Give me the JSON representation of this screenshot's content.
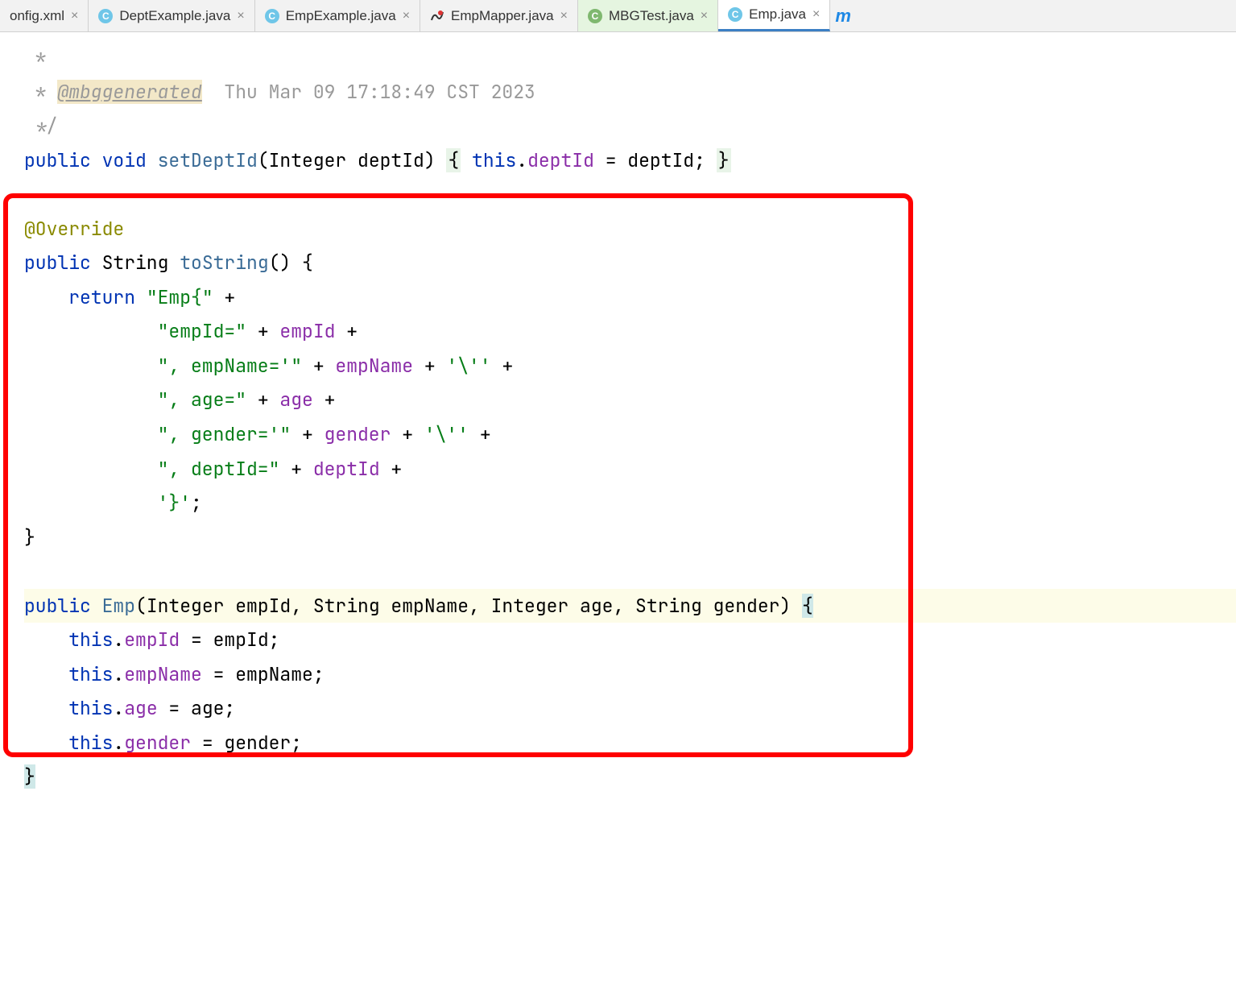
{
  "tabs": [
    {
      "label": "onfig.xml",
      "icon": null
    },
    {
      "label": "DeptExample.java",
      "icon": "c"
    },
    {
      "label": "EmpExample.java",
      "icon": "c"
    },
    {
      "label": "EmpMapper.java",
      "icon": "mapper"
    },
    {
      "label": "MBGTest.java",
      "icon": "c-green"
    },
    {
      "label": "Emp.java",
      "icon": "c"
    }
  ],
  "close_x": "×",
  "m_icon": "m",
  "code": {
    "c0": " *",
    "c1_pre": " * ",
    "c1_anno": "@mbggenerated",
    "c1_post": "  Thu Mar 09 17:18:49 CST 2023",
    "c2": " */",
    "l3_pub": "public ",
    "l3_void": "void ",
    "l3_method": "setDeptId",
    "l3_lparen": "(Integer deptId) ",
    "l3_lbrace": "{",
    "l3_this": " this",
    "l3_dot": ".",
    "l3_field": "deptId",
    "l3_assign": " = deptId; ",
    "l3_rbrace": "}",
    "l5_override": "@Override",
    "l6_pub": "public ",
    "l6_str": "String ",
    "l6_method": "toString",
    "l6_rest": "() {",
    "l7_return": "    return ",
    "l7_str": "\"Emp{\"",
    "l7_plus": " +",
    "l8_str": "            \"empId=\"",
    "l8_plus": " + ",
    "l8_field": "empId",
    "l8_plus2": " +",
    "l9_str": "            \", empName='\"",
    "l9_plus": " + ",
    "l9_field": "empName",
    "l9_plus2": " + ",
    "l9_str2": "'\\''",
    "l9_plus3": " +",
    "l10_str": "            \", age=\"",
    "l10_plus": " + ",
    "l10_field": "age",
    "l10_plus2": " +",
    "l11_str": "            \", gender='\"",
    "l11_plus": " + ",
    "l11_field": "gender",
    "l11_plus2": " + ",
    "l11_str2": "'\\''",
    "l11_plus3": " +",
    "l12_str": "            \", deptId=\"",
    "l12_plus": " + ",
    "l12_field": "deptId",
    "l12_plus2": " +",
    "l13_str": "            '}'",
    "l13_semi": ";",
    "l14": "}",
    "l16_pub": "public ",
    "l16_emp": "Emp",
    "l16_params": "(Integer empId, String empName, Integer age, String gender) ",
    "l16_lbrace": "{",
    "l17_this": "    this",
    "l17_dot": ".",
    "l17_field": "empId",
    "l17_rest": " = empId;",
    "l18_this": "    this",
    "l18_dot": ".",
    "l18_field": "empName",
    "l18_rest": " = empName;",
    "l19_this": "    this",
    "l19_dot": ".",
    "l19_field": "age",
    "l19_rest": " = age;",
    "l20_this": "    this",
    "l20_dot": ".",
    "l20_field": "gender",
    "l20_rest": " = gender;",
    "l21_rbrace": "}"
  }
}
